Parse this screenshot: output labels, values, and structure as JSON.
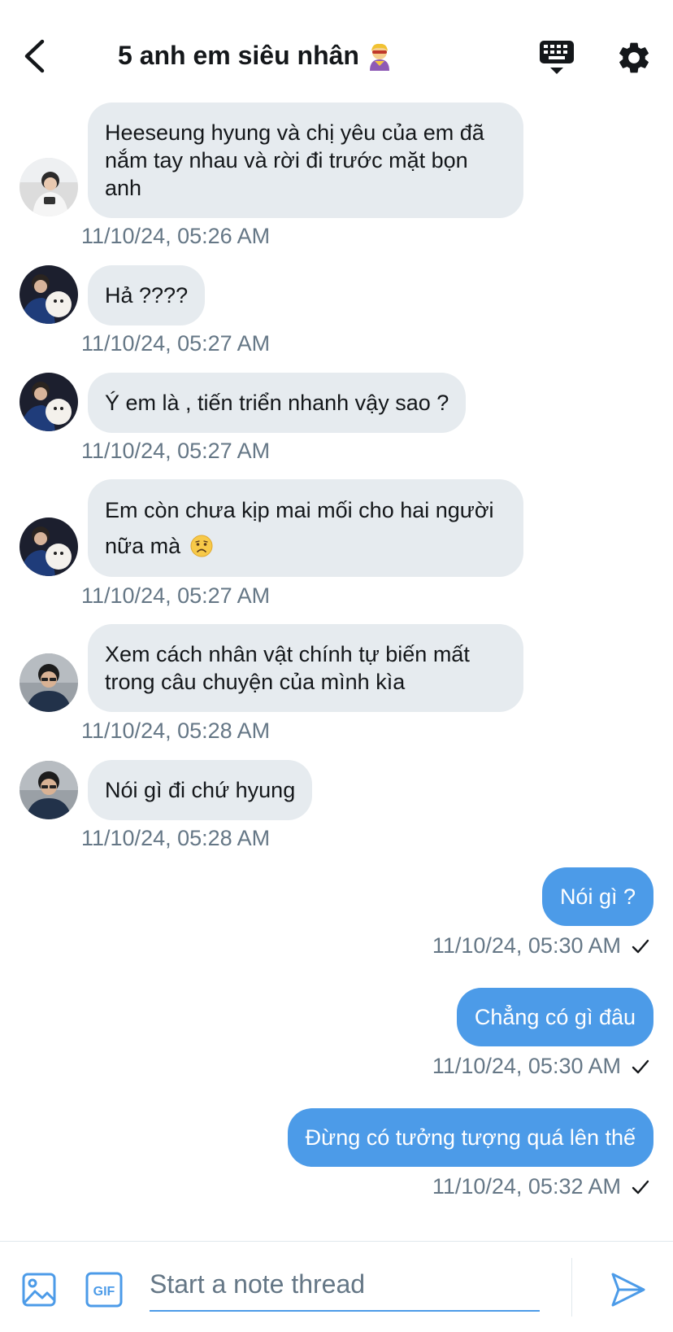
{
  "header": {
    "title": "5 anh em siêu nhân",
    "title_emoji_icon": "superhero-emoji",
    "back_icon": "chevron-left-icon",
    "keyboard_icon": "keyboard-hide-icon",
    "settings_icon": "gear-icon"
  },
  "messages": [
    {
      "direction": "in",
      "text": "Heeseung hyung và chị yêu của em đã nắm tay nhau và rời đi trước mặt bọn anh",
      "timestamp": "11/10/24, 05:26 AM",
      "avatar": "avatar-1"
    },
    {
      "direction": "in",
      "text": "Hả ????",
      "timestamp": "11/10/24, 05:27 AM",
      "avatar": "avatar-2"
    },
    {
      "direction": "in",
      "text": "Ý em là , tiến triển nhanh vậy sao ?",
      "timestamp": "11/10/24, 05:27 AM",
      "avatar": "avatar-2"
    },
    {
      "direction": "in",
      "text": "Em còn chưa kịp mai mối cho hai người nữa mà",
      "emoji": "worried-face",
      "timestamp": "11/10/24, 05:27 AM",
      "avatar": "avatar-2"
    },
    {
      "direction": "in",
      "text": "Xem cách nhân vật chính tự biến mất trong câu chuyện của mình kìa",
      "timestamp": "11/10/24, 05:28 AM",
      "avatar": "avatar-3"
    },
    {
      "direction": "in",
      "text": "Nói gì đi chứ hyung",
      "timestamp": "11/10/24, 05:28 AM",
      "avatar": "avatar-3"
    },
    {
      "direction": "out",
      "text": "Nói gì ?",
      "timestamp": "11/10/24, 05:30 AM"
    },
    {
      "direction": "out",
      "text": "Chẳng có gì đâu",
      "timestamp": "11/10/24, 05:30 AM"
    },
    {
      "direction": "out",
      "text": "Đừng có tưởng tượng quá lên thế",
      "timestamp": "11/10/24, 05:32 AM"
    }
  ],
  "composer": {
    "placeholder": "Start a note thread",
    "gif_label": "GIF",
    "media_icon": "image-icon",
    "send_icon": "send-icon"
  },
  "colors": {
    "accent": "#4c9be8",
    "incoming_bubble": "#e6ebef",
    "timestamp": "#657786"
  }
}
